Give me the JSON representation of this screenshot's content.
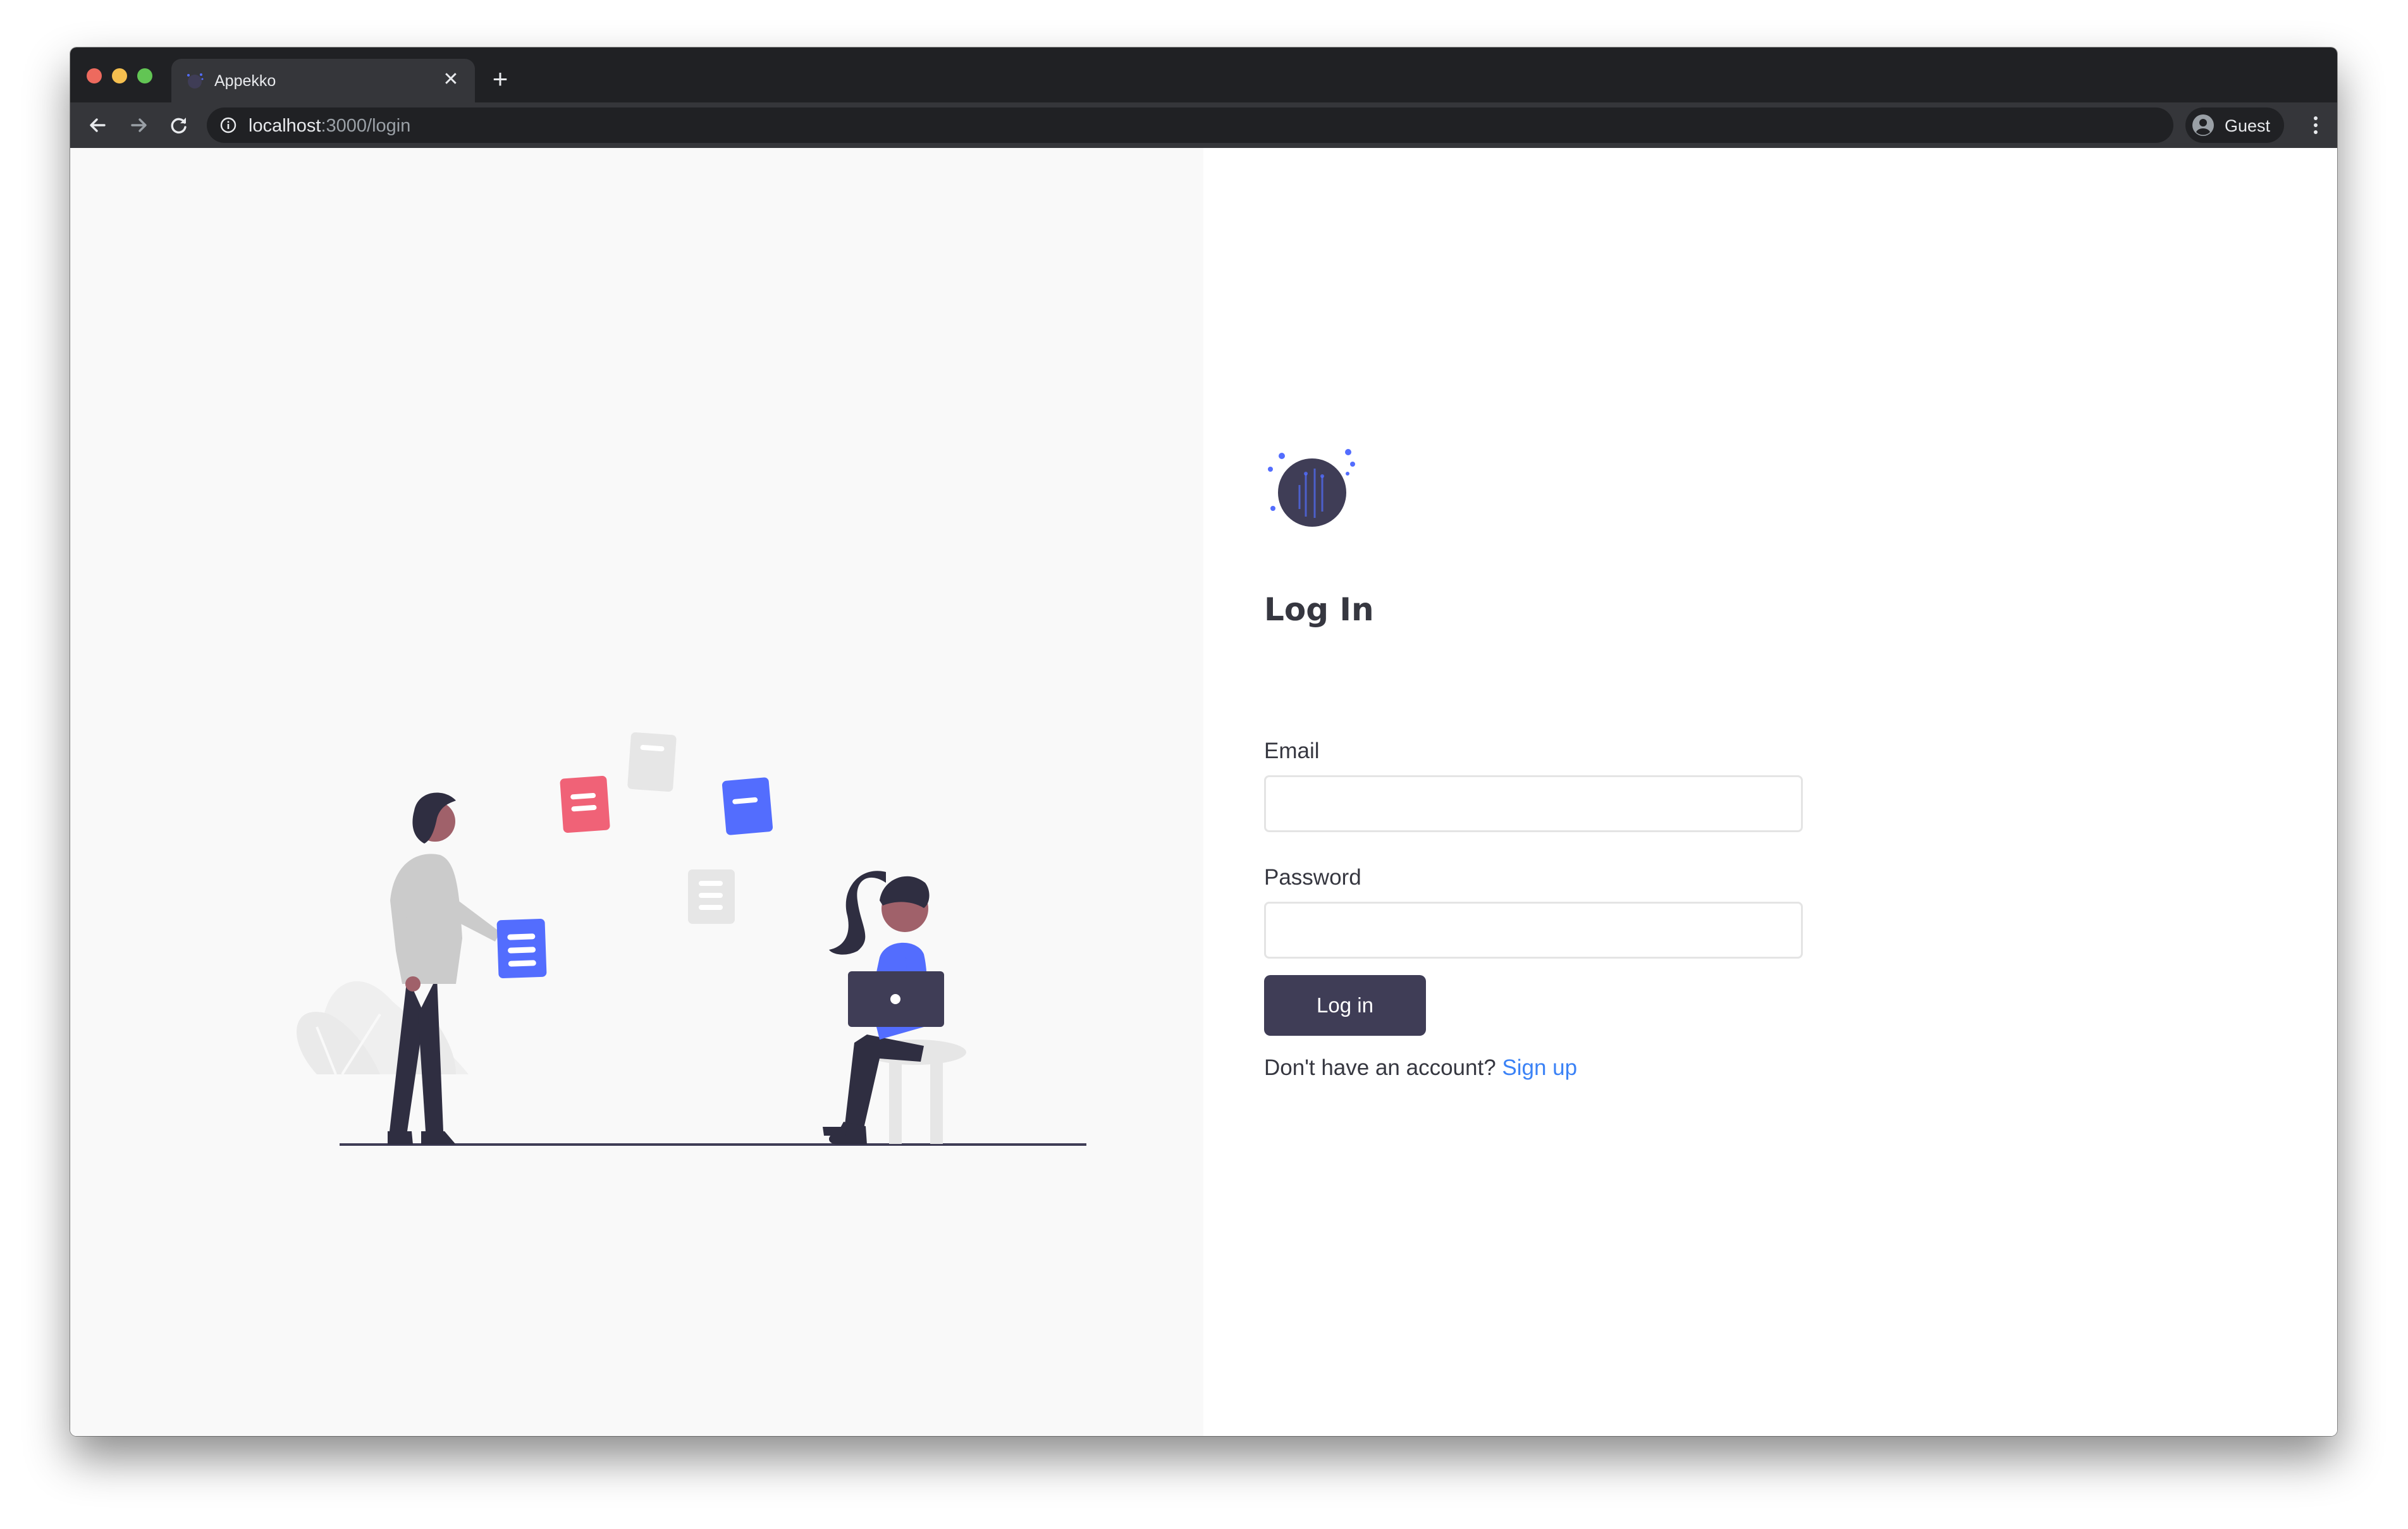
{
  "browser": {
    "tab": {
      "title": "Appekko",
      "close_glyph": "✕"
    },
    "new_tab_glyph": "+",
    "url": {
      "host": "localhost",
      "path": ":3000/login"
    },
    "profile": {
      "label": "Guest",
      "icon": "account-circle-icon"
    },
    "icons": [
      "back-icon",
      "forward-icon",
      "reload-icon",
      "info-icon",
      "menu-icon"
    ]
  },
  "login": {
    "heading": "Log In",
    "email_label": "Email",
    "email_value": "",
    "password_label": "Password",
    "password_value": "",
    "submit_label": "Log in",
    "signup_prompt": "Don't have an account? ",
    "signup_link": "Sign up"
  },
  "colors": {
    "primary": "#3f3d56",
    "accent_blue": "#536dfe",
    "accent_pink": "#f06277",
    "link": "#3b82f6",
    "left_pane_bg": "#f9f9f9"
  }
}
